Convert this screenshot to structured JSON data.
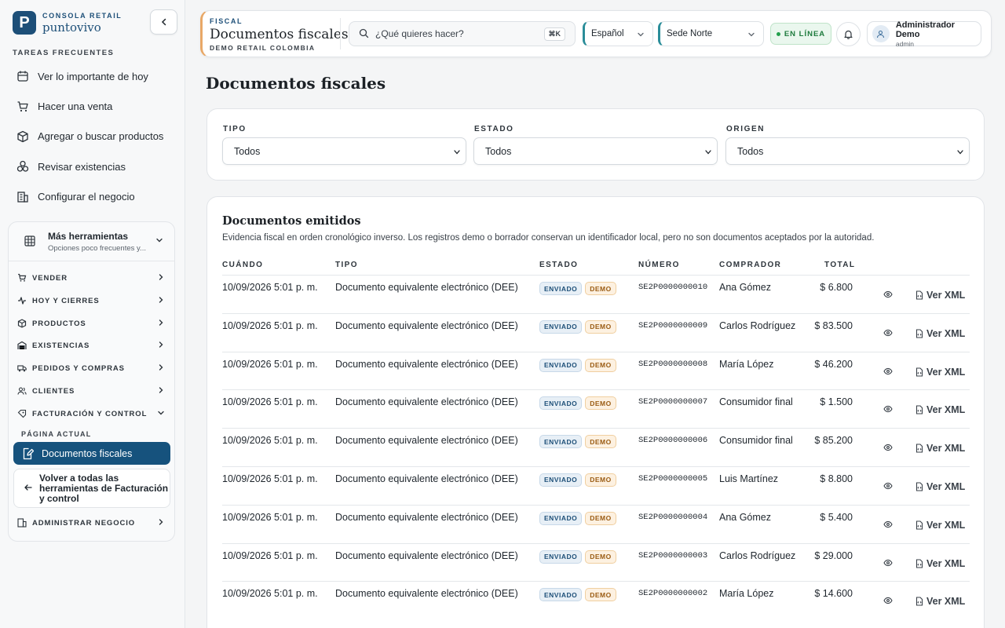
{
  "brand": {
    "kicker": "CONSOLA RETAIL",
    "name": "puntovivo",
    "logo_letter": "P"
  },
  "sidebar": {
    "section_title": "TAREAS FRECUENTES",
    "quick_items": [
      {
        "label": "Ver lo importante de hoy",
        "icon": "calendar-icon"
      },
      {
        "label": "Hacer una venta",
        "icon": "cart-icon"
      },
      {
        "label": "Agregar o buscar productos",
        "icon": "package-search-icon"
      },
      {
        "label": "Revisar existencias",
        "icon": "boxes-icon"
      },
      {
        "label": "Configurar el negocio",
        "icon": "building-icon"
      }
    ],
    "tools": {
      "title": "Más herramientas",
      "subtitle": "Opciones poco frecuentes y...",
      "groups": [
        {
          "label": "VENDER",
          "icon": "cart-icon"
        },
        {
          "label": "HOY Y CIERRES",
          "icon": "activity-icon"
        },
        {
          "label": "PRODUCTOS",
          "icon": "package-icon"
        },
        {
          "label": "EXISTENCIAS",
          "icon": "warehouse-icon"
        },
        {
          "label": "PEDIDOS Y COMPRAS",
          "icon": "truck-icon"
        },
        {
          "label": "CLIENTES",
          "icon": "users-icon"
        },
        {
          "label": "FACTURACIÓN Y CONTROL",
          "icon": "receipt-icon"
        }
      ],
      "current_label": "PÁGINA ACTUAL",
      "current_item": "Documentos fiscales",
      "back_item": "Volver a todas las herramientas de Facturación y control",
      "admin_group": "ADMINISTRAR NEGOCIO"
    }
  },
  "topbar": {
    "kicker": "FISCAL",
    "title": "Documentos fiscales",
    "subtitle": "DEMO RETAIL COLOMBIA",
    "search_placeholder": "¿Qué quieres hacer?",
    "shortcut": "⌘K",
    "language": "Español",
    "branch": "Sede Norte",
    "status": "EN LÍNEA",
    "user_name": "Administrador Demo",
    "user_role": "admin"
  },
  "page": {
    "title": "Documentos fiscales"
  },
  "filters": [
    {
      "label": "TIPO",
      "value": "Todos"
    },
    {
      "label": "ESTADO",
      "value": "Todos"
    },
    {
      "label": "ORIGEN",
      "value": "Todos"
    }
  ],
  "docs": {
    "title": "Documentos emitidos",
    "description": "Evidencia fiscal en orden cronológico inverso. Los registros demo o borrador conservan un identificador local, pero no son documentos aceptados por la autoridad.",
    "columns": {
      "when": "CUÁNDO",
      "type": "TIPO",
      "status": "ESTADO",
      "number": "NÚMERO",
      "buyer": "COMPRADOR",
      "total": "TOTAL"
    },
    "action_label": "Ver XML",
    "rows": [
      {
        "when": "10/09/2026 5:01 p. m.",
        "type": "Documento equivalente electrónico (DEE)",
        "status": "ENVIADO",
        "flag": "DEMO",
        "number": "SE2P0000000010",
        "buyer": "Ana Gómez",
        "total": "$ 6.800"
      },
      {
        "when": "10/09/2026 5:01 p. m.",
        "type": "Documento equivalente electrónico (DEE)",
        "status": "ENVIADO",
        "flag": "DEMO",
        "number": "SE2P0000000009",
        "buyer": "Carlos Rodríguez",
        "total": "$ 83.500"
      },
      {
        "when": "10/09/2026 5:01 p. m.",
        "type": "Documento equivalente electrónico (DEE)",
        "status": "ENVIADO",
        "flag": "DEMO",
        "number": "SE2P0000000008",
        "buyer": "María López",
        "total": "$ 46.200"
      },
      {
        "when": "10/09/2026 5:01 p. m.",
        "type": "Documento equivalente electrónico (DEE)",
        "status": "ENVIADO",
        "flag": "DEMO",
        "number": "SE2P0000000007",
        "buyer": "Consumidor final",
        "total": "$ 1.500"
      },
      {
        "when": "10/09/2026 5:01 p. m.",
        "type": "Documento equivalente electrónico (DEE)",
        "status": "ENVIADO",
        "flag": "DEMO",
        "number": "SE2P0000000006",
        "buyer": "Consumidor final",
        "total": "$ 85.200"
      },
      {
        "when": "10/09/2026 5:01 p. m.",
        "type": "Documento equivalente electrónico (DEE)",
        "status": "ENVIADO",
        "flag": "DEMO",
        "number": "SE2P0000000005",
        "buyer": "Luis Martínez",
        "total": "$ 8.800"
      },
      {
        "when": "10/09/2026 5:01 p. m.",
        "type": "Documento equivalente electrónico (DEE)",
        "status": "ENVIADO",
        "flag": "DEMO",
        "number": "SE2P0000000004",
        "buyer": "Ana Gómez",
        "total": "$ 5.400"
      },
      {
        "when": "10/09/2026 5:01 p. m.",
        "type": "Documento equivalente electrónico (DEE)",
        "status": "ENVIADO",
        "flag": "DEMO",
        "number": "SE2P0000000003",
        "buyer": "Carlos Rodríguez",
        "total": "$ 29.000"
      },
      {
        "when": "10/09/2026 5:01 p. m.",
        "type": "Documento equivalente electrónico (DEE)",
        "status": "ENVIADO",
        "flag": "DEMO",
        "number": "SE2P0000000002",
        "buyer": "María López",
        "total": "$ 14.600"
      }
    ]
  },
  "colors": {
    "brand": "#1d4f78",
    "accent_orange": "#e8a867",
    "accent_teal": "#2a8d99",
    "online_green": "#1d7a3c"
  }
}
